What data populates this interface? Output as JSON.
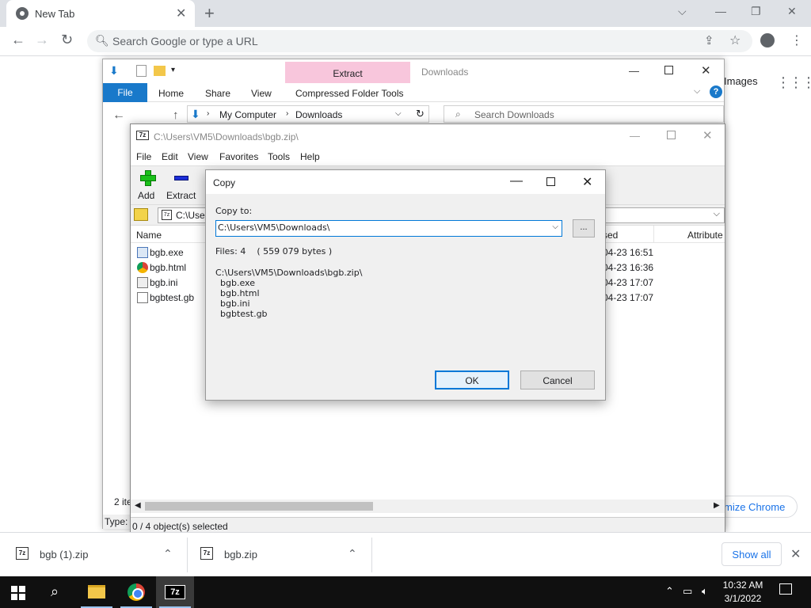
{
  "chrome": {
    "tab_title": "New Tab",
    "omnibox_placeholder": "Search Google or type a URL",
    "images_link": "Images",
    "customize_label": "mize Chrome"
  },
  "explorer": {
    "extract_tab": "Extract",
    "window_title": "Downloads",
    "ribbon": {
      "file": "File",
      "tabs": [
        "Home",
        "Share",
        "View",
        "Compressed Folder Tools"
      ]
    },
    "breadcrumb": [
      "My Computer",
      "Downloads"
    ],
    "search_placeholder": "Search Downloads",
    "items_count": "2 ite",
    "type_label": "Type:"
  },
  "sevenzip": {
    "title": "C:\\Users\\VM5\\Downloads\\bgb.zip\\",
    "menu": [
      "File",
      "Edit",
      "View",
      "Favorites",
      "Tools",
      "Help"
    ],
    "toolbar": {
      "add": "Add",
      "extract": "Extract"
    },
    "address": "C:\\User",
    "columns": {
      "name": "Name",
      "modified": "sed",
      "attributes": "Attribute"
    },
    "files": [
      {
        "name": "bgb.exe",
        "icon": "exe-icon",
        "modified": "04-23 16:51"
      },
      {
        "name": "bgb.html",
        "icon": "chrome-html-icon",
        "modified": "04-23 16:36"
      },
      {
        "name": "bgb.ini",
        "icon": "ini-icon",
        "modified": "04-23 17:07"
      },
      {
        "name": "bgbtest.gb",
        "icon": "file-icon",
        "modified": "04-23 17:07"
      }
    ],
    "status": "0 / 4 object(s) selected"
  },
  "copy_dialog": {
    "title": "Copy",
    "copy_to_label": "Copy to:",
    "path_value": "C:\\Users\\VM5\\Downloads\\",
    "browse_label": "...",
    "files_info": "Files: 4    ( 559 079 bytes )",
    "archive_path": "C:\\Users\\VM5\\Downloads\\bgb.zip\\",
    "file_list": [
      "bgb.exe",
      "bgb.html",
      "bgb.ini",
      "bgbtest.gb"
    ],
    "ok_label": "OK",
    "cancel_label": "Cancel"
  },
  "downloads": {
    "items": [
      {
        "name": "bgb (1).zip"
      },
      {
        "name": "bgb.zip"
      }
    ],
    "show_all": "Show all"
  },
  "taskbar": {
    "time": "10:32 AM",
    "date": "3/1/2022"
  },
  "colors": {
    "accent": "#0078d7",
    "ribbon_file": "#1979ca",
    "extract_tab": "#f8c6dc",
    "chrome_link": "#1a73e8"
  }
}
